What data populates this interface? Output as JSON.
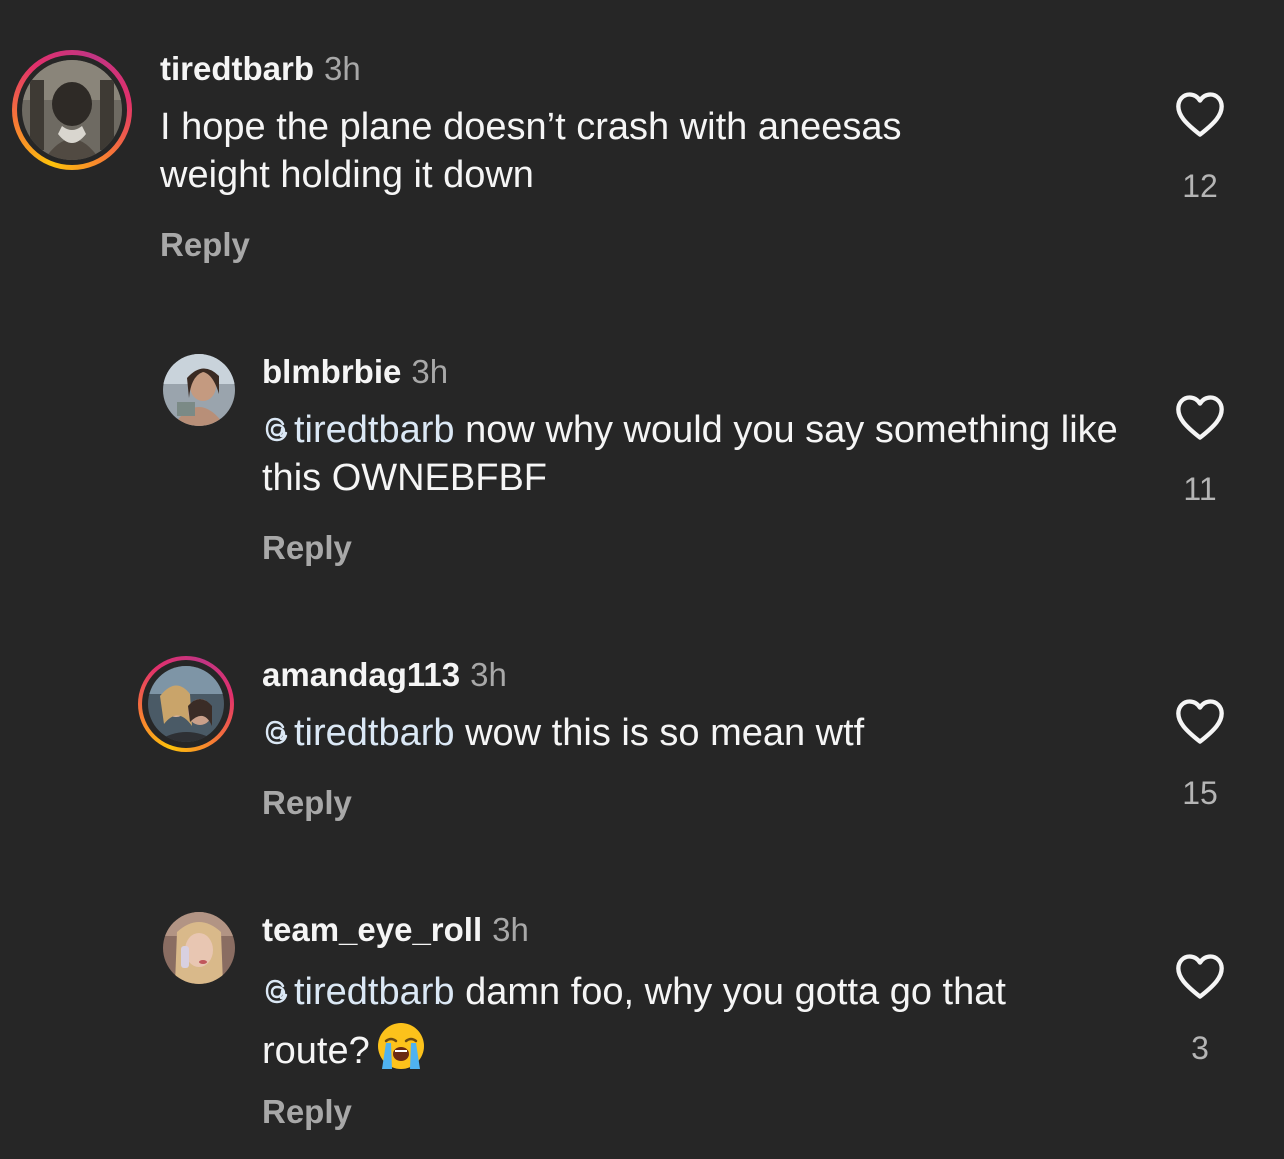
{
  "comments": [
    {
      "username": "tiredtbarb",
      "time": "3h",
      "mention": "",
      "text": "I hope the plane doesn’t crash with aneesas weight holding it down",
      "reply_label": "Reply",
      "likes": "12",
      "story_ring": true
    },
    {
      "username": "blmbrbie",
      "time": "3h",
      "mention": "tiredtbarb",
      "text": " now why would you say something like this OWNEBFBF",
      "reply_label": "Reply",
      "likes": "11",
      "story_ring": false
    },
    {
      "username": "amandag113",
      "time": "3h",
      "mention": "tiredtbarb",
      "text": " wow this is so mean wtf",
      "reply_label": "Reply",
      "likes": "15",
      "story_ring": true
    },
    {
      "username": "team_eye_roll",
      "time": "3h",
      "mention": "tiredtbarb",
      "text": " damn foo, why you gotta go that route?",
      "emoji": "loudly-crying-face",
      "reply_label": "Reply",
      "likes": "3",
      "story_ring": false
    }
  ],
  "icons": {
    "like": "heart-outline-icon",
    "mention": "threads-at-icon"
  },
  "colors": {
    "background": "#262626",
    "primary_text": "#f5f5f5",
    "secondary_text": "#a8a8a8",
    "mention": "#dbe8f5"
  }
}
